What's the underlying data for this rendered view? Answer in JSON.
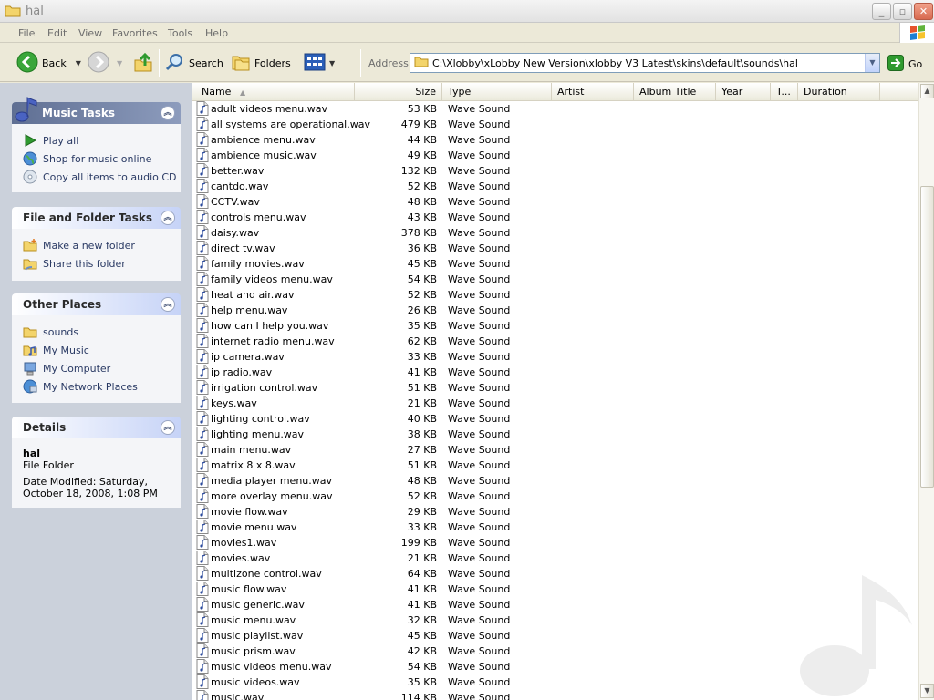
{
  "window": {
    "title": "hal"
  },
  "menu": [
    "File",
    "Edit",
    "View",
    "Favorites",
    "Tools",
    "Help"
  ],
  "toolbar": {
    "back": "Back",
    "search": "Search",
    "folders": "Folders",
    "address_label": "Address",
    "address_value": "C:\\Xlobby\\xLobby New Version\\xlobby V3 Latest\\skins\\default\\sounds\\hal",
    "go": "Go"
  },
  "taskpane": {
    "music_tasks": {
      "title": "Music Tasks",
      "items": [
        "Play all",
        "Shop for music online",
        "Copy all items to audio CD"
      ]
    },
    "file_folder_tasks": {
      "title": "File and Folder Tasks",
      "items": [
        "Make a new folder",
        "Share this folder"
      ]
    },
    "other_places": {
      "title": "Other Places",
      "items": [
        "sounds",
        "My Music",
        "My Computer",
        "My Network Places"
      ]
    },
    "details": {
      "title": "Details",
      "name": "hal",
      "kind": "File Folder",
      "modified_line1": "Date Modified: Saturday,",
      "modified_line2": "October 18, 2008, 1:08 PM"
    }
  },
  "columns": [
    "Name",
    "Size",
    "Type",
    "Artist",
    "Album Title",
    "Year",
    "T...",
    "Duration"
  ],
  "files": [
    {
      "name": "adult videos menu.wav",
      "size": "53 KB",
      "type": "Wave Sound"
    },
    {
      "name": "all systems are operational.wav",
      "size": "479 KB",
      "type": "Wave Sound"
    },
    {
      "name": "ambience menu.wav",
      "size": "44 KB",
      "type": "Wave Sound"
    },
    {
      "name": "ambience music.wav",
      "size": "49 KB",
      "type": "Wave Sound"
    },
    {
      "name": "better.wav",
      "size": "132 KB",
      "type": "Wave Sound"
    },
    {
      "name": "cantdo.wav",
      "size": "52 KB",
      "type": "Wave Sound"
    },
    {
      "name": "CCTV.wav",
      "size": "48 KB",
      "type": "Wave Sound"
    },
    {
      "name": "controls menu.wav",
      "size": "43 KB",
      "type": "Wave Sound"
    },
    {
      "name": "daisy.wav",
      "size": "378 KB",
      "type": "Wave Sound"
    },
    {
      "name": "direct tv.wav",
      "size": "36 KB",
      "type": "Wave Sound"
    },
    {
      "name": "family movies.wav",
      "size": "45 KB",
      "type": "Wave Sound"
    },
    {
      "name": "family videos menu.wav",
      "size": "54 KB",
      "type": "Wave Sound"
    },
    {
      "name": "heat and air.wav",
      "size": "52 KB",
      "type": "Wave Sound"
    },
    {
      "name": "help menu.wav",
      "size": "26 KB",
      "type": "Wave Sound"
    },
    {
      "name": "how can I help you.wav",
      "size": "35 KB",
      "type": "Wave Sound"
    },
    {
      "name": "internet radio menu.wav",
      "size": "62 KB",
      "type": "Wave Sound"
    },
    {
      "name": "ip camera.wav",
      "size": "33 KB",
      "type": "Wave Sound"
    },
    {
      "name": "ip radio.wav",
      "size": "41 KB",
      "type": "Wave Sound"
    },
    {
      "name": "irrigation control.wav",
      "size": "51 KB",
      "type": "Wave Sound"
    },
    {
      "name": "keys.wav",
      "size": "21 KB",
      "type": "Wave Sound"
    },
    {
      "name": "lighting control.wav",
      "size": "40 KB",
      "type": "Wave Sound"
    },
    {
      "name": "lighting menu.wav",
      "size": "38 KB",
      "type": "Wave Sound"
    },
    {
      "name": "main menu.wav",
      "size": "27 KB",
      "type": "Wave Sound"
    },
    {
      "name": "matrix 8 x 8.wav",
      "size": "51 KB",
      "type": "Wave Sound"
    },
    {
      "name": "media player menu.wav",
      "size": "48 KB",
      "type": "Wave Sound"
    },
    {
      "name": "more overlay menu.wav",
      "size": "52 KB",
      "type": "Wave Sound"
    },
    {
      "name": "movie flow.wav",
      "size": "29 KB",
      "type": "Wave Sound"
    },
    {
      "name": "movie menu.wav",
      "size": "33 KB",
      "type": "Wave Sound"
    },
    {
      "name": "movies1.wav",
      "size": "199 KB",
      "type": "Wave Sound"
    },
    {
      "name": "movies.wav",
      "size": "21 KB",
      "type": "Wave Sound"
    },
    {
      "name": "multizone control.wav",
      "size": "64 KB",
      "type": "Wave Sound"
    },
    {
      "name": "music flow.wav",
      "size": "41 KB",
      "type": "Wave Sound"
    },
    {
      "name": "music generic.wav",
      "size": "41 KB",
      "type": "Wave Sound"
    },
    {
      "name": "music menu.wav",
      "size": "32 KB",
      "type": "Wave Sound"
    },
    {
      "name": "music playlist.wav",
      "size": "45 KB",
      "type": "Wave Sound"
    },
    {
      "name": "music prism.wav",
      "size": "42 KB",
      "type": "Wave Sound"
    },
    {
      "name": "music videos menu.wav",
      "size": "54 KB",
      "type": "Wave Sound"
    },
    {
      "name": "music videos.wav",
      "size": "35 KB",
      "type": "Wave Sound"
    },
    {
      "name": "music.wav",
      "size": "114 KB",
      "type": "Wave Sound"
    }
  ],
  "colors": {
    "taskpane_bg": "#cbd1db",
    "panel_body": "#f4f5f8",
    "link_text": "#2a3a64",
    "address_border": "#7f9db9",
    "go_green": "#2f9a2f"
  }
}
